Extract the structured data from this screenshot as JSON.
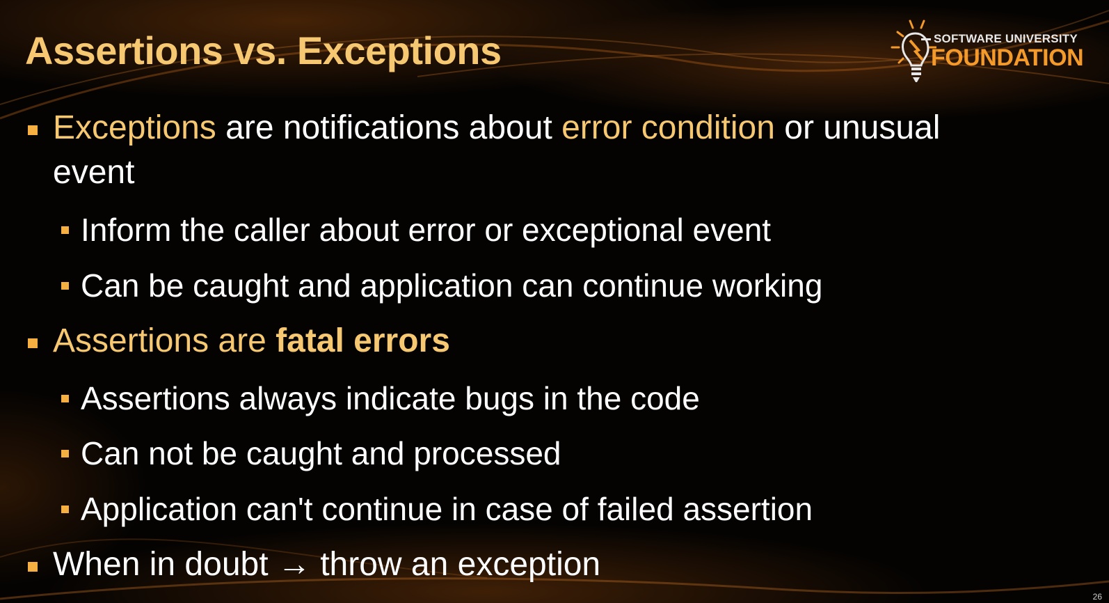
{
  "slide": {
    "title": "Assertions vs. Exceptions",
    "page_number": "26"
  },
  "logo": {
    "top_text": "SOFTWARE UNIVERSITY",
    "bottom_text": "FOUNDATION"
  },
  "bullets": [
    {
      "line1_part1": "Exceptions",
      "line1_part2": " are notifications about ",
      "line1_part3": "error condition",
      "line1_part4": " or unusual",
      "line2": "event"
    },
    {
      "text": "Inform the caller about error or exceptional event"
    },
    {
      "text": "Can be caught and application can continue working"
    },
    {
      "part1": "Assertions are ",
      "part2": "fatal errors"
    },
    {
      "text": "Assertions always indicate bugs in the code"
    },
    {
      "text": "Can not be caught and processed"
    },
    {
      "text": "Application can't continue in case of failed assertion"
    },
    {
      "part1": "When in doubt ",
      "arrow": "→",
      "part2": " throw an exception"
    }
  ],
  "colors": {
    "accent": "#f7c872",
    "bullet": "#f5b041",
    "logo_orange": "#f39a2a",
    "background": "#050302"
  }
}
